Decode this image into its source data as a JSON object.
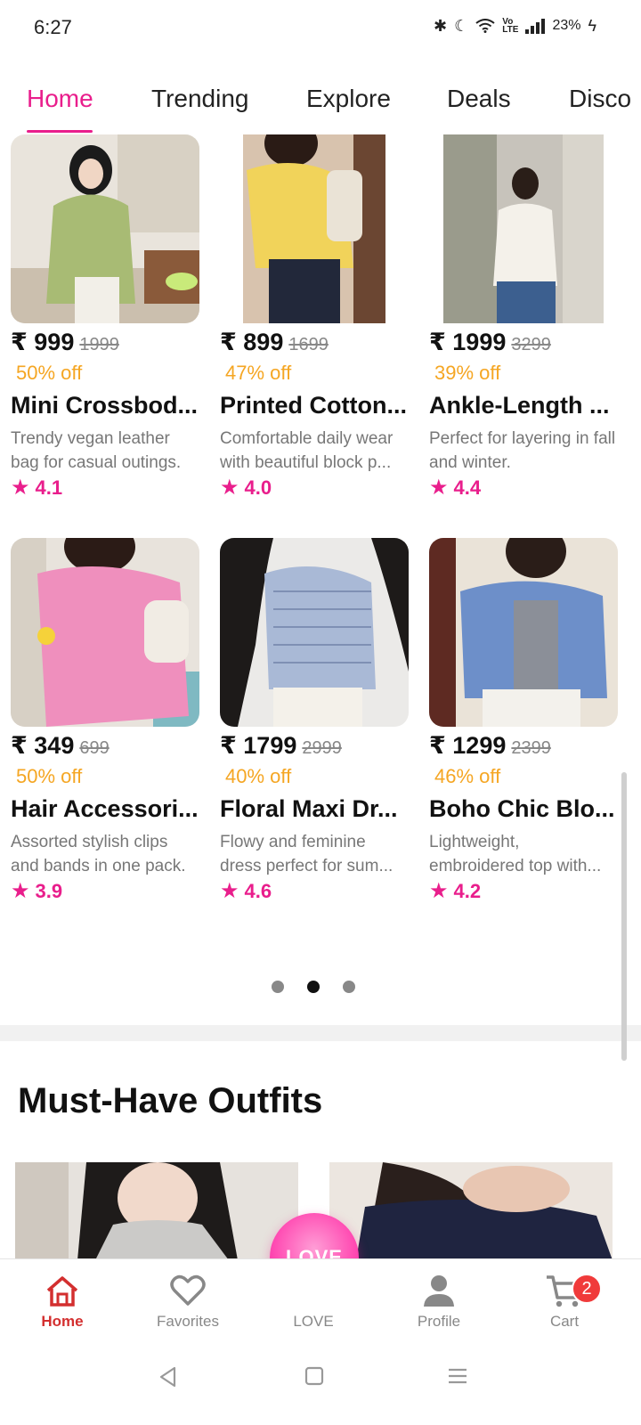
{
  "status": {
    "time": "6:27",
    "battery": "23%",
    "network_label": "VoLTE"
  },
  "tabs": [
    {
      "label": "Home",
      "active": true
    },
    {
      "label": "Trending",
      "active": false
    },
    {
      "label": "Explore",
      "active": false
    },
    {
      "label": "Deals",
      "active": false
    },
    {
      "label": "Disco",
      "active": false
    }
  ],
  "products": [
    {
      "price": "₹ 999",
      "mrp": "1999",
      "discount": "50% off",
      "title": "Mini Crossbod...",
      "desc": "Trendy vegan leather bag for casual outings.",
      "rating": "4.1",
      "image": "woman-green-shirt-photo"
    },
    {
      "price": "₹ 899",
      "mrp": "1699",
      "discount": "47% off",
      "title": "Printed Cotton...",
      "desc": "Comfortable daily wear with beautiful block p...",
      "rating": "4.0",
      "image": "woman-yellow-shirt-photo"
    },
    {
      "price": "₹ 1999",
      "mrp": "3299",
      "discount": "39% off",
      "title": "Ankle-Length ...",
      "desc": "Perfect for layering in fall and winter.",
      "rating": "4.4",
      "image": "woman-white-blouse-photo"
    },
    {
      "price": "₹ 349",
      "mrp": "699",
      "discount": "50% off",
      "title": "Hair Accessori...",
      "desc": "Assorted stylish clips and bands in one pack.",
      "rating": "3.9",
      "image": "woman-pink-top-photo"
    },
    {
      "price": "₹ 1799",
      "mrp": "2999",
      "discount": "40% off",
      "title": "Floral Maxi Dr...",
      "desc": "Flowy and feminine dress perfect for sum...",
      "rating": "4.6",
      "image": "woman-striped-shirt-photo"
    },
    {
      "price": "₹ 1299",
      "mrp": "2399",
      "discount": "46% off",
      "title": "Boho Chic Blo...",
      "desc": "Lightweight, embroidered top with...",
      "rating": "4.2",
      "image": "woman-blue-cardigan-photo"
    }
  ],
  "carousel": {
    "pages": 3,
    "active_index": 1
  },
  "section": {
    "title": "Must-Have Outfits"
  },
  "bottom_nav": {
    "home": "Home",
    "favorites": "Favorites",
    "love_button": "LOVE",
    "love": "LOVE",
    "profile": "Profile",
    "cart": "Cart",
    "cart_count": "2"
  },
  "colors": {
    "accent": "#e91e8c",
    "discount": "#f5a623",
    "active_nav": "#d32f2f",
    "badge": "#f03a3a"
  }
}
